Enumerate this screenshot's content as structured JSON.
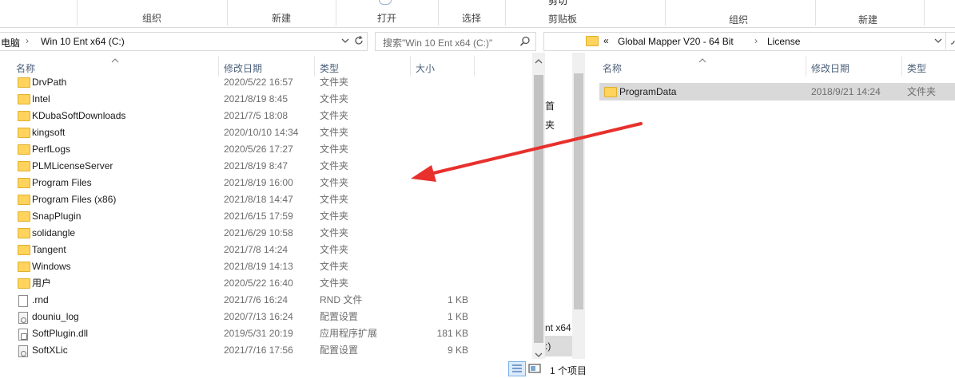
{
  "left": {
    "ribbon": {
      "groups": [
        "组织",
        "新建",
        "打开",
        "选择"
      ]
    },
    "address": {
      "crumbs": [
        "电脑",
        "Win 10 Ent x64 (C:)"
      ],
      "chevron": "›"
    },
    "search": {
      "placeholder": "搜索\"Win 10 Ent x64 (C:)\""
    },
    "columns": {
      "name": "名称",
      "date": "修改日期",
      "type": "类型",
      "size": "大小"
    },
    "rows": [
      {
        "name": "DrvPath",
        "date": "2020/5/22 16:57",
        "type": "文件夹",
        "size": "",
        "icon": "folder"
      },
      {
        "name": "Intel",
        "date": "2021/8/19 8:45",
        "type": "文件夹",
        "size": "",
        "icon": "folder"
      },
      {
        "name": "KDubaSoftDownloads",
        "date": "2021/7/5 18:08",
        "type": "文件夹",
        "size": "",
        "icon": "folder"
      },
      {
        "name": "kingsoft",
        "date": "2020/10/10 14:34",
        "type": "文件夹",
        "size": "",
        "icon": "folder"
      },
      {
        "name": "PerfLogs",
        "date": "2020/5/26 17:27",
        "type": "文件夹",
        "size": "",
        "icon": "folder"
      },
      {
        "name": "PLMLicenseServer",
        "date": "2021/8/19 8:47",
        "type": "文件夹",
        "size": "",
        "icon": "folder"
      },
      {
        "name": "Program Files",
        "date": "2021/8/19 16:00",
        "type": "文件夹",
        "size": "",
        "icon": "folder"
      },
      {
        "name": "Program Files (x86)",
        "date": "2021/8/18 14:47",
        "type": "文件夹",
        "size": "",
        "icon": "folder"
      },
      {
        "name": "SnapPlugin",
        "date": "2021/6/15 17:59",
        "type": "文件夹",
        "size": "",
        "icon": "folder"
      },
      {
        "name": "solidangle",
        "date": "2021/6/29 10:58",
        "type": "文件夹",
        "size": "",
        "icon": "folder"
      },
      {
        "name": "Tangent",
        "date": "2021/7/8 14:24",
        "type": "文件夹",
        "size": "",
        "icon": "folder"
      },
      {
        "name": "Windows",
        "date": "2021/8/19 14:13",
        "type": "文件夹",
        "size": "",
        "icon": "folder"
      },
      {
        "name": "用户",
        "date": "2020/5/22 16:40",
        "type": "文件夹",
        "size": "",
        "icon": "folder"
      },
      {
        "name": ".rnd",
        "date": "2021/7/6 16:24",
        "type": "RND 文件",
        "size": "1 KB",
        "icon": "file"
      },
      {
        "name": "douniu_log",
        "date": "2020/7/13 16:24",
        "type": "配置设置",
        "size": "1 KB",
        "icon": "config"
      },
      {
        "name": "SoftPlugin.dll",
        "date": "2019/5/31 20:19",
        "type": "应用程序扩展",
        "size": "181 KB",
        "icon": "dll"
      },
      {
        "name": "SoftXLic",
        "date": "2021/7/16 17:56",
        "type": "配置设置",
        "size": "9 KB",
        "icon": "config"
      }
    ]
  },
  "middle": {
    "fragments": [
      "剪切",
      "剪贴板",
      "首",
      "夹",
      "nt x64",
      ":)",
      "1 个项目"
    ]
  },
  "right": {
    "ribbon": {
      "groups": [
        "组织",
        "新建"
      ]
    },
    "address": {
      "crumbs": [
        "«",
        "Global Mapper V20 - 64 Bit",
        "License"
      ]
    },
    "columns": {
      "name": "名称",
      "date": "修改日期",
      "type": "类型"
    },
    "rows": [
      {
        "name": "ProgramData",
        "date": "2018/9/21 14:24",
        "type": "文件夹",
        "icon": "folder"
      }
    ]
  },
  "annotation": {
    "arrow_color": "#e8302c"
  }
}
